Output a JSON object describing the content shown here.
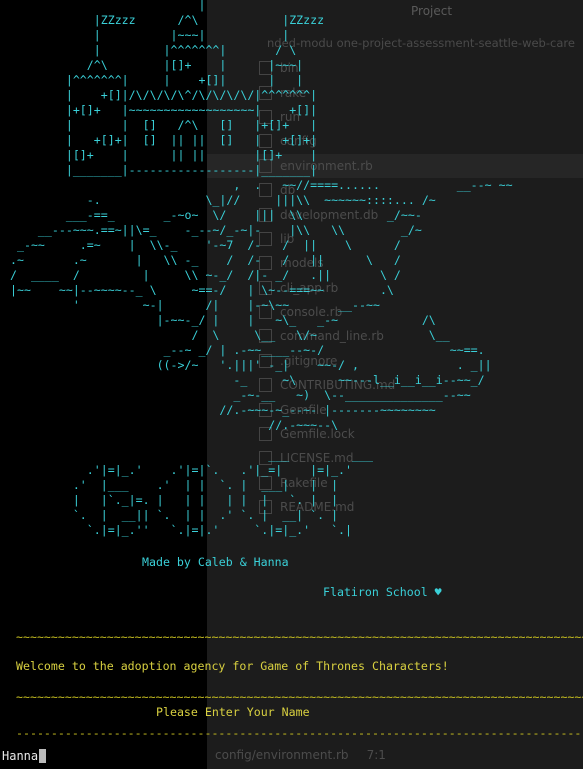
{
  "background_editor": {
    "panel_title": "Project",
    "path_text": "nded-modu    one-project-assessment-seattle-web-care",
    "tree": [
      {
        "label": "bin",
        "selected": false
      },
      {
        "label": "rake",
        "selected": false
      },
      {
        "label": "run",
        "selected": false
      },
      {
        "label": "config",
        "selected": false
      },
      {
        "label": "environment.rb",
        "selected": true
      },
      {
        "label": "db",
        "selected": false
      },
      {
        "label": "development.db",
        "selected": false
      },
      {
        "label": "lib",
        "selected": false
      },
      {
        "label": "models",
        "selected": false
      },
      {
        "label": "cli_app.rb",
        "selected": false
      },
      {
        "label": "console.rb",
        "selected": false
      },
      {
        "label": "command_line.rb",
        "selected": false
      },
      {
        "label": ".gitignore",
        "selected": false
      },
      {
        "label": "CONTRIBUTING.md",
        "selected": false
      },
      {
        "label": "Gemfile",
        "selected": false
      },
      {
        "label": "Gemfile.lock",
        "selected": false
      },
      {
        "label": "LICENSE.md",
        "selected": false
      },
      {
        "label": "Rakefile",
        "selected": false
      },
      {
        "label": "README.md",
        "selected": false
      }
    ],
    "status_file": "config/environment.rb",
    "status_pos": "7:1"
  },
  "terminal": {
    "ascii_art": "                           |\n            |ZZzzz      /^\\            |ZZzzz\n            |          |~~~|           |\n            |         |^^^^^^^|       / \\\n           /^\\        |[]+    |      |~~~|\n        |^^^^^^^|     |    +[]|      |   |\n        |    +[]|/\\/\\/\\/\\^/\\/\\/\\/\\/|^^^^^^^|\n        |+[]+   |~~~~~~~~~~~~~~~~~~|    +[]|\n        |       |  []   /^\\   []   |+[]+   |\n        |   +[]+|  []  || ||  []   |   +[]+|\n        |[]+    |      || ||       |[]+    |\n        |_______|------------------|_______|\n                                ,  .   ~~//====......           __--~ ~~\n           -.               \\_|//     |||\\\\  ~~~~~~::::... /~\n        ___-==_       _-~o~  \\/    |||  \\\\            _/~~-\n    __---~~~.==~||\\=_    -_--~/_-~|-    |\\\\   \\\\        _/~\n _-~~     .=~    |  \\\\-_    '-~7  /-   /  ||    \\      /\n.~       .~       |   \\\\ -_    /  /-   /   ||      \\   /\n/  ____  /         |     \\\\ ~-_/  /|- _/   .||       \\ /\n|~~    ~~|--~~~~--_ \\     ~==-/   | \\~--===~~        .\\\n         '         ~-|      /|    |-~\\~~       __--~~\n                     |-~~-_/ |    |   ~\\_   _-~            /\\\n                          /  \\     \\__   \\/~                \\__\n                      _--~ _/ | .-~~____--~-/                  ~~==.\n                     ((->/~   '.|||' -_|    ~~-/ ,              . _||\n                                -_     ~\\      ~~---l__i__i__i--~~_/\n                                _-~-__   ~)  \\--______________--~~\n                              //.-~~~-~_--~- |-------~~~~~~~~\n                                     //.-~~~--\\\n\n                                     ___         ___\n           .'|=|_.'    .'|=|`.   .'|_=|    |=|_.'\n         .'  |___    .'  | |  `. |  ___|   |  |\n         |   |`._|=. |   | |   | |  |   `. |  |\n         `.  |  __|| `.  | |  .' `. |  __| `. |\n           `.|=|_.''   `.|=|.'     `.|=|_.'   `.|",
    "credit": "Made by Caleb & Hanna",
    "school": "Flatiron School ♥",
    "rule_text": "~~~~~~~~~~~~~~~~~~~~~~~~~~~~~~~~~~~~~~~~~~~~~~~~~~~~~~~~~~~~~~~~~~~~~~~~~~~~~~~~~~",
    "welcome": "Welcome to the adoption agency for Game of Thrones Characters!",
    "dash_rule": "-----------------------------------------------------------------------------------",
    "prompt": "Please Enter Your Name",
    "input_value": "Hanna"
  }
}
